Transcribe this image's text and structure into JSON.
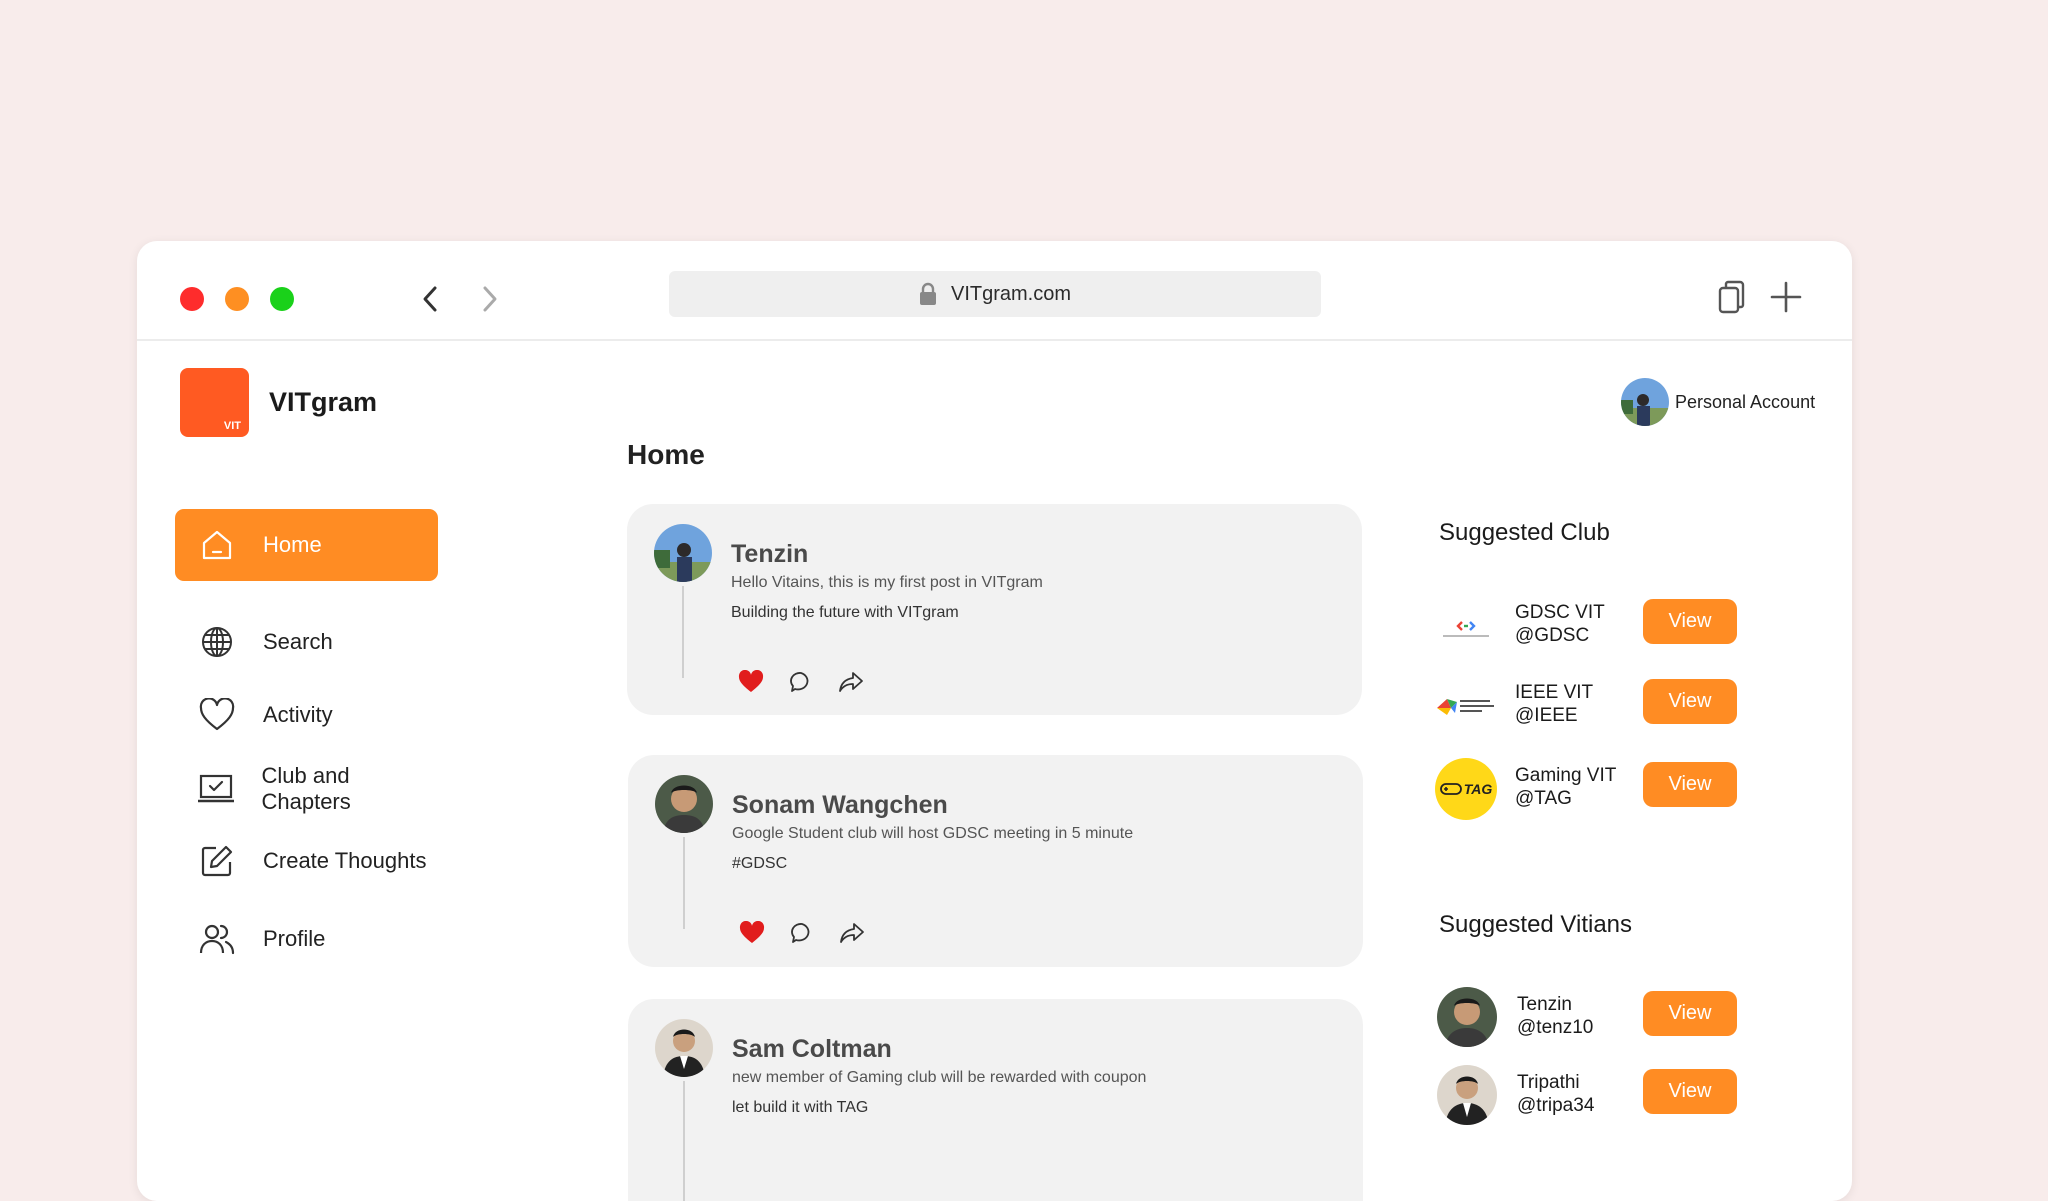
{
  "browser": {
    "url": "VITgram.com",
    "colors": {
      "close": "#fe2c2c",
      "minimize": "#fe8f22",
      "maximize": "#1ad11a"
    }
  },
  "app": {
    "brand": "VITgram",
    "logo_text": "VIT",
    "account_label": "Personal Account",
    "accent": "#ff8c23"
  },
  "sidebar": {
    "items": [
      {
        "label": "Home",
        "icon": "home-icon"
      },
      {
        "label": "Search",
        "icon": "globe-icon"
      },
      {
        "label": "Activity",
        "icon": "heart-icon"
      },
      {
        "label": "Club and Chapters",
        "icon": "laptop-check-icon"
      },
      {
        "label": "Create Thoughts",
        "icon": "edit-icon"
      },
      {
        "label": "Profile",
        "icon": "users-icon"
      }
    ]
  },
  "main": {
    "title": "Home",
    "posts": [
      {
        "name": "Tenzin",
        "line1": "Hello Vitains, this is my first post in VITgram",
        "line2": "Building the future with VITgram"
      },
      {
        "name": "Sonam Wangchen",
        "line1": "Google Student club will host GDSC meeting in 5 minute",
        "line2": "#GDSC"
      },
      {
        "name": "Sam Coltman",
        "line1": "new member of Gaming club will be rewarded with coupon",
        "line2": "let build it with TAG"
      }
    ]
  },
  "right": {
    "clubs_title": "Suggested Club",
    "clubs": [
      {
        "name": "GDSC VIT",
        "handle": "@GDSC",
        "button": "View"
      },
      {
        "name": "IEEE VIT",
        "handle": "@IEEE",
        "button": "View"
      },
      {
        "name": "Gaming VIT",
        "handle": "@TAG",
        "button": "View",
        "logo_text": "TAG"
      }
    ],
    "people_title": "Suggested Vitians",
    "people": [
      {
        "name": "Tenzin",
        "handle": "@tenz10",
        "button": "View"
      },
      {
        "name": "Tripathi",
        "handle": "@tripa34",
        "button": "View"
      }
    ]
  }
}
